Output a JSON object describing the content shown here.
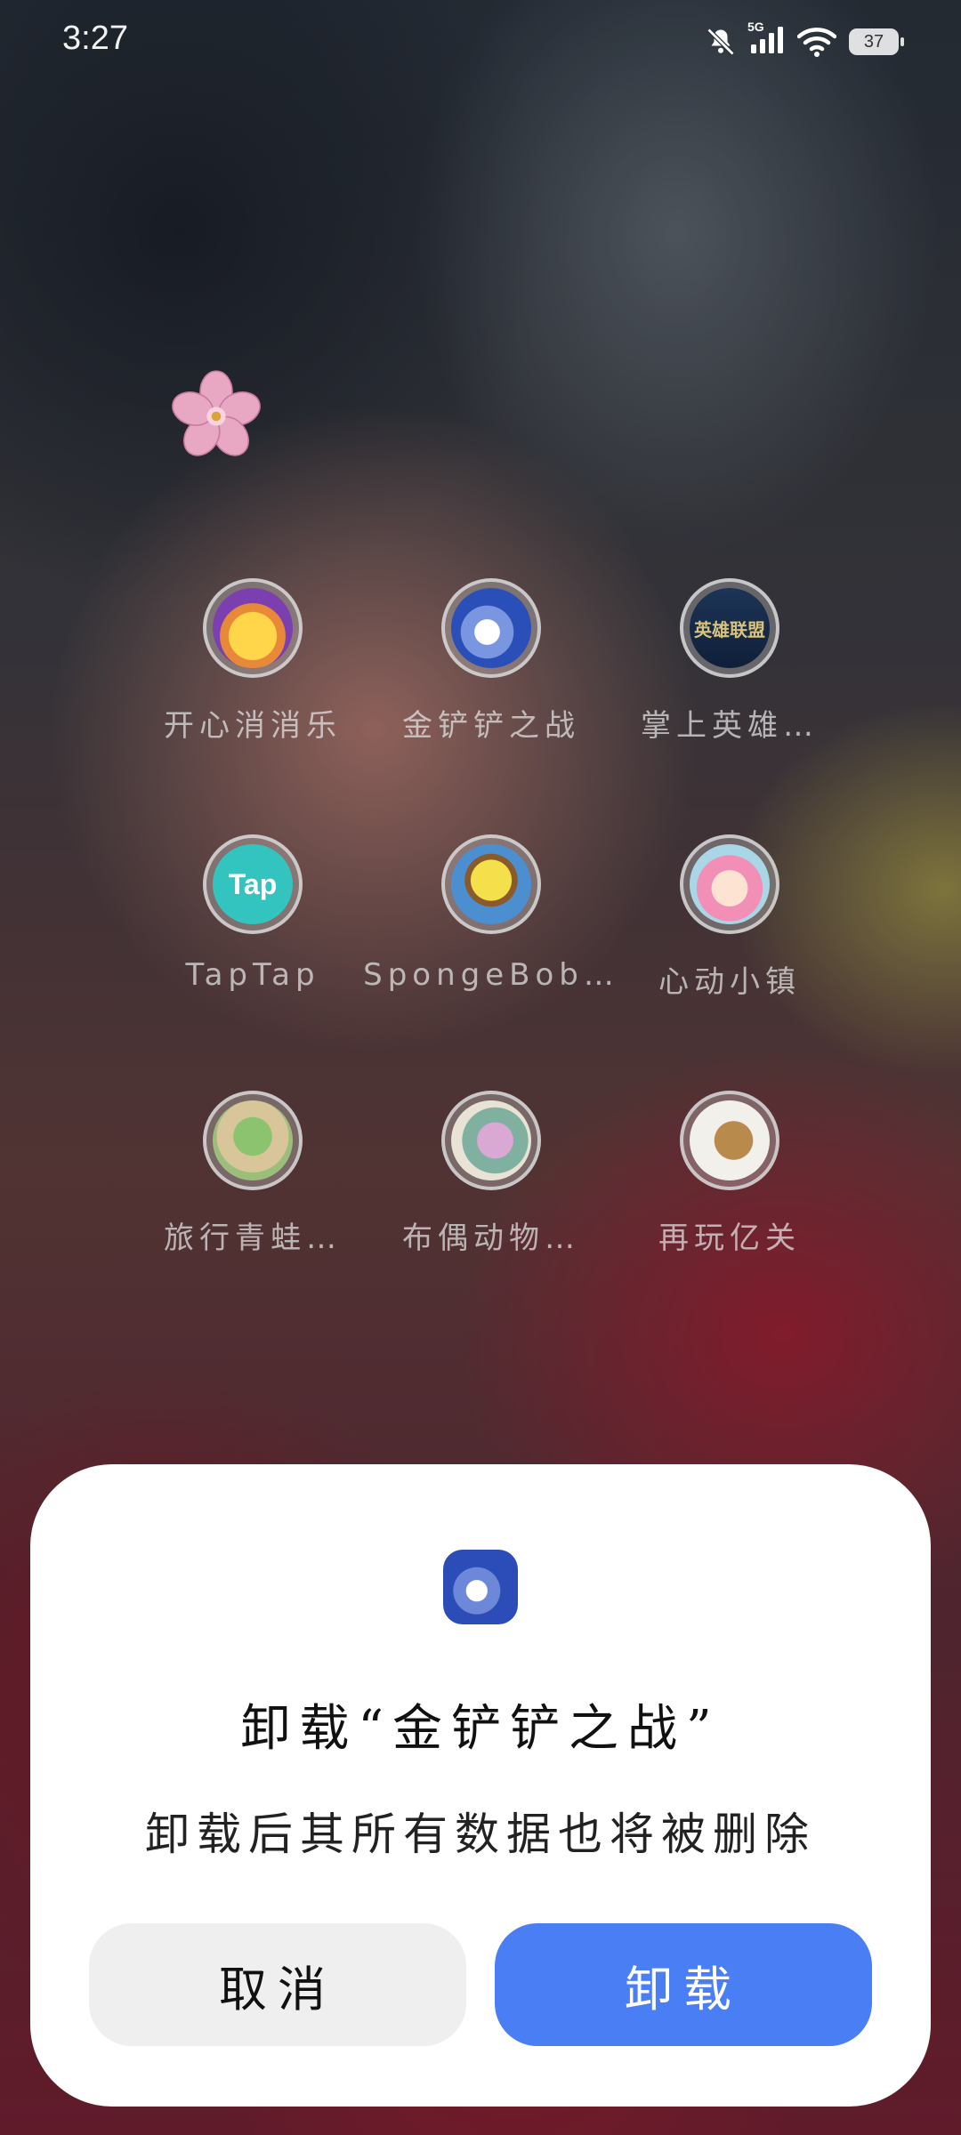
{
  "status_bar": {
    "time": "3:27",
    "network": "5G",
    "battery": "37",
    "icons": [
      "mute-bell-icon",
      "signal-icon",
      "wifi-icon",
      "battery-icon"
    ]
  },
  "apps": [
    {
      "label": "开心消消乐",
      "icon": "happy-chick-icon",
      "color": "#e8b43a"
    },
    {
      "label": "金铲铲之战",
      "icon": "penguin-icon",
      "color": "#3a66c8"
    },
    {
      "label": "掌上英雄…",
      "icon": "lol-icon",
      "color": "#1e3a66",
      "icon_text": "英雄联盟"
    },
    {
      "label": "TapTap",
      "icon": "taptap-icon",
      "color": "#33c3c0",
      "icon_text": "Tap"
    },
    {
      "label": "SpongeBob…",
      "icon": "spongebob-icon",
      "color": "#4c8fd1"
    },
    {
      "label": "心动小镇",
      "icon": "heart-town-icon",
      "color": "#f2a9c4"
    },
    {
      "label": "旅行青蛙…",
      "icon": "frog-icon",
      "color": "#7fb36a"
    },
    {
      "label": "布偶动物…",
      "icon": "plush-animal-icon",
      "color": "#c9a3c9"
    },
    {
      "label": "再玩亿关",
      "icon": "mole-icon",
      "color": "#f0efe9"
    }
  ],
  "dialog": {
    "title": "卸载“金铲铲之战”",
    "message": "卸载后其所有数据也将被删除",
    "cancel_label": "取消",
    "uninstall_label": "卸载",
    "accent_color": "#4a7ef5"
  }
}
